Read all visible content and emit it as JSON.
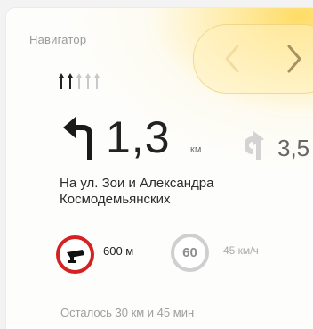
{
  "header": {
    "app_title": "Навигатор",
    "prev_icon": "chevron-left-icon",
    "next_icon": "chevron-right-icon"
  },
  "lanes": [
    {
      "direction": "straight",
      "active": true
    },
    {
      "direction": "straight",
      "active": true
    },
    {
      "direction": "straight",
      "active": false
    },
    {
      "direction": "straight",
      "active": false
    },
    {
      "direction": "straight",
      "active": false
    }
  ],
  "maneuver": {
    "icon": "turn-left-arrow-icon",
    "distance": "1,3",
    "unit": "км",
    "street": "На ул. Зои и Александра Космодемьянских"
  },
  "next_maneuver": {
    "icon": "turn-right-arrow-icon",
    "distance": "3,5"
  },
  "camera": {
    "icon": "speed-camera-icon",
    "distance": "600 м"
  },
  "speed_limit": {
    "value": "60",
    "text": "45 км/ч"
  },
  "remaining": "Осталось 30 км и 45 мин",
  "colors": {
    "accent": "#ffd44b",
    "camera_ring": "#d42121",
    "text": "#222222"
  }
}
